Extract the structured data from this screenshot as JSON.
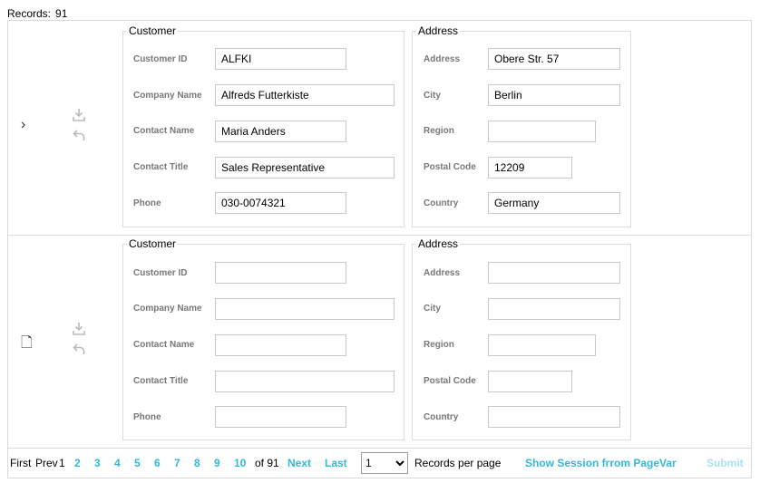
{
  "records": {
    "label": "Records:",
    "value": "91"
  },
  "rows": [
    {
      "indicator": "›",
      "customer": {
        "legend": "Customer",
        "fields": [
          {
            "label": "Customer ID",
            "value": "ALFKI"
          },
          {
            "label": "Company Name",
            "value": "Alfreds Futterkiste"
          },
          {
            "label": "Contact Name",
            "value": "Maria Anders"
          },
          {
            "label": "Contact Title",
            "value": "Sales Representative"
          },
          {
            "label": "Phone",
            "value": "030-0074321"
          }
        ]
      },
      "address": {
        "legend": "Address",
        "fields": [
          {
            "label": "Address",
            "value": "Obere Str. 57"
          },
          {
            "label": "City",
            "value": "Berlin"
          },
          {
            "label": "Region",
            "value": ""
          },
          {
            "label": "Postal Code",
            "value": "12209"
          },
          {
            "label": "Country",
            "value": "Germany"
          }
        ]
      }
    },
    {
      "indicator": "🗋",
      "customer": {
        "legend": "Customer",
        "fields": [
          {
            "label": "Customer ID",
            "value": ""
          },
          {
            "label": "Company Name",
            "value": ""
          },
          {
            "label": "Contact Name",
            "value": ""
          },
          {
            "label": "Contact Title",
            "value": ""
          },
          {
            "label": "Phone",
            "value": ""
          }
        ]
      },
      "address": {
        "legend": "Address",
        "fields": [
          {
            "label": "Address",
            "value": ""
          },
          {
            "label": "City",
            "value": ""
          },
          {
            "label": "Region",
            "value": ""
          },
          {
            "label": "Postal Code",
            "value": ""
          },
          {
            "label": "Country",
            "value": ""
          }
        ]
      }
    }
  ],
  "icons": {
    "save": "save-icon",
    "undo": "undo-icon",
    "indicator_current": "chevron-right-icon",
    "indicator_new": "new-record-icon"
  },
  "pager": {
    "first": "First",
    "prev": "Prev",
    "current_page": "1",
    "pages": [
      "2",
      "3",
      "4",
      "5",
      "6",
      "7",
      "8",
      "9",
      "10"
    ],
    "of_total": "of 91",
    "next": "Next",
    "last": "Last",
    "records_per_page_value": "1",
    "records_per_page_label": "Records per page",
    "session_link": "Show Session frrom PageVar",
    "submit": "Submit"
  },
  "colors": {
    "link": "#34b7d6",
    "submit_disabled": "#a8e1ef",
    "label": "#777777"
  }
}
